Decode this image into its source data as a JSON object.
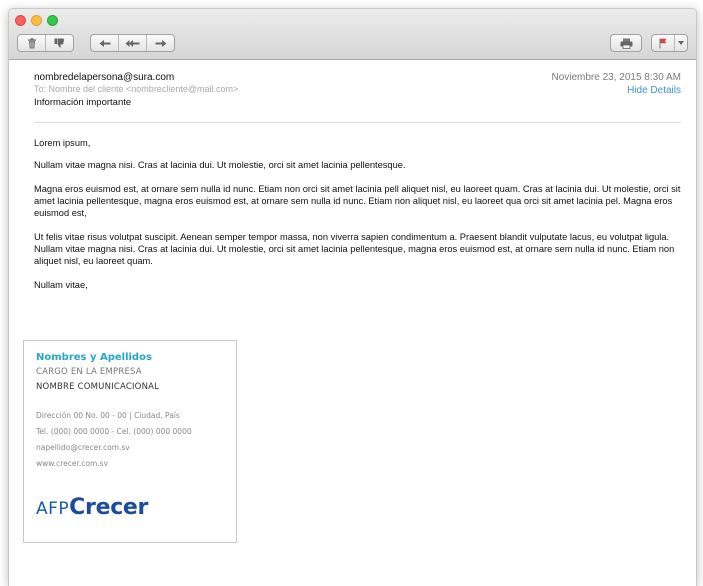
{
  "window": {
    "traffic_lights": [
      "close",
      "minimize",
      "zoom"
    ]
  },
  "toolbar": {
    "left_buttons": [
      {
        "icon": "trash-icon"
      },
      {
        "icon": "thumbs-down-icon"
      }
    ],
    "nav_buttons": [
      {
        "icon": "reply-icon"
      },
      {
        "icon": "reply-all-icon"
      },
      {
        "icon": "forward-icon"
      }
    ],
    "right_buttons": [
      {
        "icon": "printer-icon"
      },
      {
        "icon": "flag-icon"
      }
    ],
    "flag_color": "#e0413a"
  },
  "message": {
    "from": "nombredelapersona@sura.com",
    "to": "To: Nombre del cliente <nombrecliente@mail.com>",
    "subject": "Información importante",
    "date": "Noviembre 23, 2015 8:30 AM",
    "hide_details": "Hide Details",
    "body": {
      "greeting": "Lorem ipsum,",
      "p1": "Nullam vitae magna nisi. Cras at lacinia dui. Ut molestie, orci sit amet lacinia pellentesque.",
      "p2": "Magna eros euismod est, at ornare sem nulla id nunc. Etiam non orci sit amet lacinia pell aliquet nisl, eu laoreet quam. Cras at lacinia dui. Ut molestie, orci sit amet lacinia pellentesque, magna eros euismod est, at ornare sem nulla id nunc. Etiam non aliquet nisl, eu laoreet qua orci sit amet lacinia pel. Magna eros euismod est,",
      "p3": "Ut felis vitae risus volutpat suscipit. Aenean semper tempor massa, non viverra sapien condimentum a. Praesent blandit vulputate lacus, eu volutpat ligula. Nullam vitae magna nisi. Cras at lacinia dui. Ut molestie, orci sit amet lacinia pellentesque, magna eros euismod est, at ornare sem nulla id nunc. Etiam non aliquet nisl, eu laoreet quam.",
      "closing": "Nullam vitae,"
    }
  },
  "signature": {
    "name": "Nombres y Apellidos",
    "cargo": "CARGO EN LA EMPRESA",
    "area": "NOMBRE COMUNICACIONAL",
    "address": "Dirección 00 No. 00 - 00 | Ciudad, País",
    "phones": "Tel. (000) 000 0000 - Cel. (000) 000 0000",
    "email": "napellido@crecer.com.sv",
    "web": "www.crecer.com.sv",
    "logo_afp": "AFP",
    "logo_crecer": "Crecer",
    "name_color": "#27a6c9",
    "logo_color": "#1b4d9a"
  }
}
